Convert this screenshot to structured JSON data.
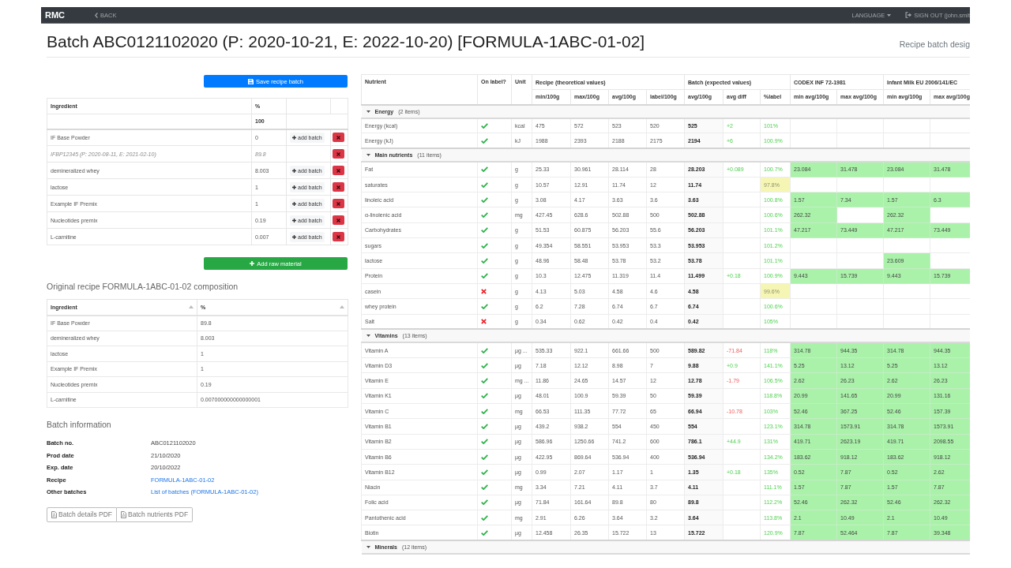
{
  "navbar": {
    "brand": "RMC",
    "back": "BACK",
    "language": "LANGUAGE",
    "sign_out": "SIGN OUT (john.smit"
  },
  "title": "Batch ABC0121102020 (P: 2020-10-21, E: 2022-10-20) [FORMULA-1ABC-01-02]",
  "subtitle": "Recipe batch desig",
  "recipe_batch": {
    "save_button": "Save recipe batch",
    "columns": [
      "Ingredient",
      "%"
    ],
    "total": "100",
    "rows": [
      {
        "kind": "ingredient",
        "name": "IF Base Powder",
        "percent": "0",
        "add_button": "add batch"
      },
      {
        "kind": "batch",
        "name": "IFBP12345 (P: 2020-08-11, E: 2021-02-10)",
        "percent": "89.8"
      },
      {
        "kind": "ingredient",
        "name": "demineralized whey",
        "percent": "8.003",
        "add_button": "add batch"
      },
      {
        "kind": "ingredient",
        "name": "lactose",
        "percent": "1",
        "add_button": "add batch"
      },
      {
        "kind": "ingredient",
        "name": "Example IF Premix",
        "percent": "1",
        "add_button": "add batch"
      },
      {
        "kind": "ingredient",
        "name": "Nucleotides premix",
        "percent": "0.19",
        "add_button": "add batch"
      },
      {
        "kind": "ingredient",
        "name": "L-carnitine",
        "percent": "0.007",
        "add_button": "add batch"
      }
    ],
    "add_button": "Add raw material"
  },
  "composition": {
    "title": "Original recipe FORMULA-1ABC-01-02 composition",
    "columns": [
      {
        "label": "Ingredient",
        "sortable": true
      },
      {
        "label": "%",
        "sortable": true
      }
    ],
    "rows": [
      [
        "IF Base Powder",
        "89.8"
      ],
      [
        "demineralized whey",
        "8.003"
      ],
      [
        "lactose",
        "1"
      ],
      [
        "Example IF Premix",
        "1"
      ],
      [
        "Nucleotides premix",
        "0.19"
      ],
      [
        "L-carnitine",
        "0.007000000000000001"
      ]
    ]
  },
  "batch_info": {
    "title": "Batch information",
    "fields": [
      {
        "label": "Batch no.",
        "value": "ABC0121102020",
        "kind": "text"
      },
      {
        "label": "Prod date",
        "value": "21/10/2020",
        "kind": "text"
      },
      {
        "label": "Exp. date",
        "value": "20/10/2022",
        "kind": "text"
      },
      {
        "label": "Recipe",
        "value": "FORMULA-1ABC-01-02",
        "kind": "link"
      },
      {
        "label": "Other batches",
        "value": "List of batches (FORMULA-1ABC-01-02)",
        "kind": "link"
      }
    ],
    "pdf_buttons": [
      "Batch details PDF",
      "Batch nutrients PDF"
    ]
  },
  "nutrients": {
    "columns": [
      "Nutrient",
      "On label?",
      "Unit"
    ],
    "column_groups": [
      {
        "title": "Recipe (theoretical values)",
        "columns": [
          "min/100g",
          "max/100g",
          "avg/100g",
          "label/100g"
        ]
      },
      {
        "title": "Batch (expected values)",
        "columns": [
          "avg/100g",
          "avg diff",
          "%label"
        ]
      },
      {
        "title": "CODEX INF 72-1981",
        "columns": [
          "min avg/100g",
          "max avg/100g"
        ]
      },
      {
        "title": "Infant Milk EU 2006/141/EC",
        "columns": [
          "min avg/100g",
          "max avg/100g"
        ]
      }
    ],
    "groups": [
      {
        "name": "Energy",
        "count": "(2 items)",
        "expanded": true,
        "rows": [
          {
            "nutrient": "Energy (kcal)",
            "on_label": true,
            "unit": "kcal",
            "recipe": [
              "475",
              "572",
              "523",
              "520"
            ],
            "batch_avg": "525",
            "avg_diff": "+2",
            "diff_negative": false,
            "pct_label": "101%",
            "below_label": false
          },
          {
            "nutrient": "Energy (kJ)",
            "on_label": true,
            "unit": "kJ",
            "recipe": [
              "1988",
              "2393",
              "2188",
              "2175"
            ],
            "batch_avg": "2194",
            "avg_diff": "+6",
            "diff_negative": false,
            "pct_label": "100.9%",
            "below_label": false
          }
        ]
      },
      {
        "name": "Main nutrients",
        "count": "(11 items)",
        "expanded": true,
        "rows": [
          {
            "nutrient": "Fat",
            "on_label": true,
            "unit": "g",
            "recipe": [
              "25.33",
              "30.961",
              "28.114",
              "28"
            ],
            "batch_avg": "28.203",
            "avg_diff": "+0.089",
            "diff_negative": false,
            "pct_label": "100.7%",
            "below_label": false,
            "codex_min": "23.084",
            "codex_max": "31.478",
            "eu_min": "23.084",
            "eu_max": "31.478"
          },
          {
            "nutrient": "saturates",
            "on_label": true,
            "unit": "g",
            "recipe": [
              "10.57",
              "12.91",
              "11.74",
              "12"
            ],
            "batch_avg": "11.74",
            "pct_label": "97.8%",
            "below_label": true
          },
          {
            "nutrient": "linoleic acid",
            "on_label": true,
            "unit": "g",
            "recipe": [
              "3.08",
              "4.17",
              "3.63",
              "3.6"
            ],
            "batch_avg": "3.63",
            "pct_label": "100.8%",
            "below_label": false,
            "codex_min": "1.57",
            "codex_max": "7.34",
            "eu_min": "1.57",
            "eu_max": "6.3"
          },
          {
            "nutrient": "α-linolenic acid",
            "on_label": true,
            "unit": "mg",
            "recipe": [
              "427.45",
              "628.6",
              "502.88",
              "500"
            ],
            "batch_avg": "502.88",
            "pct_label": "100.6%",
            "below_label": false,
            "codex_min": "262.32",
            "eu_min": "262.32"
          },
          {
            "nutrient": "Carbohydrates",
            "on_label": true,
            "unit": "g",
            "recipe": [
              "51.53",
              "60.875",
              "56.203",
              "55.6"
            ],
            "batch_avg": "56.203",
            "pct_label": "101.1%",
            "below_label": false,
            "codex_min": "47.217",
            "codex_max": "73.449",
            "eu_min": "47.217",
            "eu_max": "73.449"
          },
          {
            "nutrient": "sugars",
            "on_label": true,
            "unit": "g",
            "recipe": [
              "49.354",
              "58.551",
              "53.953",
              "53.3"
            ],
            "batch_avg": "53.953",
            "pct_label": "101.2%",
            "below_label": false
          },
          {
            "nutrient": "lactose",
            "on_label": true,
            "unit": "g",
            "recipe": [
              "48.96",
              "58.48",
              "53.78",
              "53.2"
            ],
            "batch_avg": "53.78",
            "pct_label": "101.1%",
            "below_label": false,
            "eu_min": "23.609"
          },
          {
            "nutrient": "Protein",
            "on_label": true,
            "unit": "g",
            "recipe": [
              "10.3",
              "12.475",
              "11.319",
              "11.4"
            ],
            "batch_avg": "11.499",
            "avg_diff": "+0.18",
            "diff_negative": false,
            "pct_label": "100.9%",
            "below_label": false,
            "codex_min": "9.443",
            "codex_max": "15.739",
            "eu_min": "9.443",
            "eu_max": "15.739"
          },
          {
            "nutrient": "casein",
            "on_label": false,
            "unit": "g",
            "recipe": [
              "4.13",
              "5.03",
              "4.58",
              "4.6"
            ],
            "batch_avg": "4.58",
            "pct_label": "99.6%",
            "below_label": true
          },
          {
            "nutrient": "whey protein",
            "on_label": true,
            "unit": "g",
            "recipe": [
              "6.2",
              "7.28",
              "6.74",
              "6.7"
            ],
            "batch_avg": "6.74",
            "pct_label": "100.6%",
            "below_label": false
          },
          {
            "nutrient": "Salt",
            "on_label": false,
            "unit": "g",
            "recipe": [
              "0.34",
              "0.62",
              "0.42",
              "0.4"
            ],
            "batch_avg": "0.42",
            "pct_label": "105%",
            "below_label": false
          }
        ]
      },
      {
        "name": "Vitamins",
        "count": "(13 items)",
        "expanded": true,
        "rows": [
          {
            "nutrient": "Vitamin A",
            "on_label": true,
            "unit": "µg ...",
            "recipe": [
              "535.33",
              "922.1",
              "661.66",
              "500"
            ],
            "batch_avg": "589.82",
            "avg_diff": "-71.84",
            "diff_negative": true,
            "pct_label": "118%",
            "below_label": false,
            "codex_min": "314.78",
            "codex_max": "944.35",
            "eu_min": "314.78",
            "eu_max": "944.35"
          },
          {
            "nutrient": "Vitamin D3",
            "on_label": true,
            "unit": "µg",
            "recipe": [
              "7.18",
              "12.12",
              "8.98",
              "7"
            ],
            "batch_avg": "9.88",
            "avg_diff": "+0.9",
            "diff_negative": false,
            "pct_label": "141.1%",
            "below_label": false,
            "codex_min": "5.25",
            "codex_max": "13.12",
            "eu_min": "5.25",
            "eu_max": "13.12"
          },
          {
            "nutrient": "Vitamin E",
            "on_label": true,
            "unit": "mg ...",
            "recipe": [
              "11.86",
              "24.65",
              "14.57",
              "12"
            ],
            "batch_avg": "12.78",
            "avg_diff": "-1.79",
            "diff_negative": true,
            "pct_label": "106.5%",
            "below_label": false,
            "codex_min": "2.62",
            "codex_max": "26.23",
            "eu_min": "2.62",
            "eu_max": "26.23"
          },
          {
            "nutrient": "Vitamin K1",
            "on_label": true,
            "unit": "µg",
            "recipe": [
              "48.01",
              "100.9",
              "59.39",
              "50"
            ],
            "batch_avg": "59.39",
            "pct_label": "118.8%",
            "below_label": false,
            "codex_min": "20.99",
            "codex_max": "141.65",
            "eu_min": "20.99",
            "eu_max": "131.16"
          },
          {
            "nutrient": "Vitamin C",
            "on_label": true,
            "unit": "mg",
            "recipe": [
              "66.53",
              "111.35",
              "77.72",
              "65"
            ],
            "batch_avg": "66.94",
            "avg_diff": "-10.78",
            "diff_negative": true,
            "pct_label": "103%",
            "below_label": false,
            "codex_min": "52.46",
            "codex_max": "367.25",
            "eu_min": "52.46",
            "eu_max": "157.39"
          },
          {
            "nutrient": "Vitamin B1",
            "on_label": true,
            "unit": "µg",
            "recipe": [
              "439.2",
              "938.2",
              "554",
              "450"
            ],
            "batch_avg": "554",
            "pct_label": "123.1%",
            "below_label": false,
            "codex_min": "314.78",
            "codex_max": "1573.91",
            "eu_min": "314.78",
            "eu_max": "1573.91"
          },
          {
            "nutrient": "Vitamin B2",
            "on_label": true,
            "unit": "µg",
            "recipe": [
              "586.96",
              "1250.66",
              "741.2",
              "600"
            ],
            "batch_avg": "786.1",
            "avg_diff": "+44.9",
            "diff_negative": false,
            "pct_label": "131%",
            "below_label": false,
            "codex_min": "419.71",
            "codex_max": "2623.19",
            "eu_min": "419.71",
            "eu_max": "2098.55"
          },
          {
            "nutrient": "Vitamin B6",
            "on_label": true,
            "unit": "µg",
            "recipe": [
              "422.95",
              "869.64",
              "536.94",
              "400"
            ],
            "batch_avg": "536.94",
            "pct_label": "134.2%",
            "below_label": false,
            "codex_min": "183.62",
            "codex_max": "918.12",
            "eu_min": "183.62",
            "eu_max": "918.12"
          },
          {
            "nutrient": "Vitamin B12",
            "on_label": true,
            "unit": "µg",
            "recipe": [
              "0.99",
              "2.07",
              "1.17",
              "1"
            ],
            "batch_avg": "1.35",
            "avg_diff": "+0.18",
            "diff_negative": false,
            "pct_label": "135%",
            "below_label": false,
            "codex_min": "0.52",
            "codex_max": "7.87",
            "eu_min": "0.52",
            "eu_max": "2.62"
          },
          {
            "nutrient": "Niacin",
            "on_label": true,
            "unit": "mg",
            "recipe": [
              "3.34",
              "7.21",
              "4.11",
              "3.7"
            ],
            "batch_avg": "4.11",
            "pct_label": "111.1%",
            "below_label": false,
            "codex_min": "1.57",
            "codex_max": "7.87",
            "eu_min": "1.57",
            "eu_max": "7.87"
          },
          {
            "nutrient": "Folic acid",
            "on_label": true,
            "unit": "µg",
            "recipe": [
              "71.84",
              "161.64",
              "89.8",
              "80"
            ],
            "batch_avg": "89.8",
            "pct_label": "112.2%",
            "below_label": false,
            "codex_min": "52.46",
            "codex_max": "262.32",
            "eu_min": "52.46",
            "eu_max": "262.32"
          },
          {
            "nutrient": "Pantothenic acid",
            "on_label": true,
            "unit": "mg",
            "recipe": [
              "2.91",
              "6.26",
              "3.64",
              "3.2"
            ],
            "batch_avg": "3.64",
            "pct_label": "113.8%",
            "below_label": false,
            "codex_min": "2.1",
            "codex_max": "10.49",
            "eu_min": "2.1",
            "eu_max": "10.49"
          },
          {
            "nutrient": "Biotin",
            "on_label": true,
            "unit": "µg",
            "recipe": [
              "12.458",
              "26.35",
              "15.722",
              "13"
            ],
            "batch_avg": "15.722",
            "pct_label": "120.9%",
            "below_label": false,
            "codex_min": "7.87",
            "codex_max": "52.464",
            "eu_min": "7.87",
            "eu_max": "39.348"
          }
        ]
      },
      {
        "name": "Minerals",
        "count": "(12 items)",
        "expanded": true
      }
    ]
  }
}
